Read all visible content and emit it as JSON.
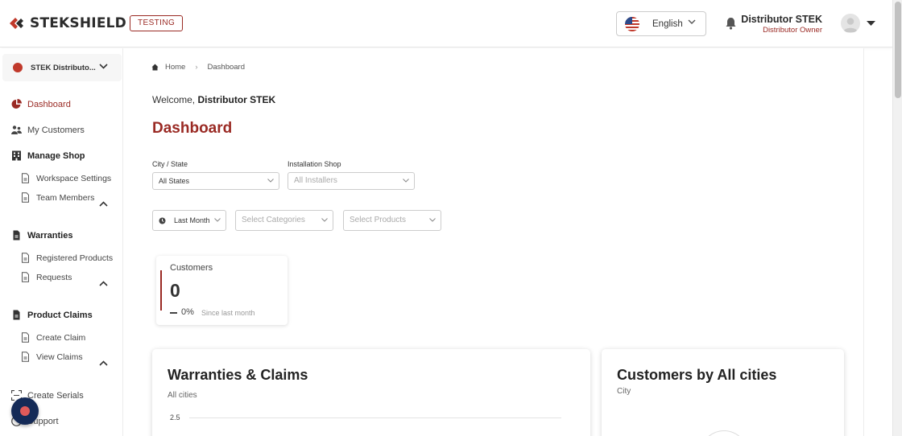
{
  "header": {
    "brand": "STEKSHIELD",
    "env_badge": "TESTING",
    "language": "English",
    "user_name": "Distributor STEK",
    "user_role": "Distributor Owner"
  },
  "sidebar": {
    "workspace": "STEK Distributo...",
    "items": [
      {
        "label": "Dashboard",
        "icon": "pie-chart-icon",
        "active": true
      },
      {
        "label": "My Customers",
        "icon": "users-icon"
      },
      {
        "label": "Manage Shop",
        "icon": "building-icon",
        "group": true,
        "expanded": true
      },
      {
        "label": "Workspace Settings",
        "icon": "document-icon"
      },
      {
        "label": "Team Members",
        "icon": "document-icon"
      },
      {
        "label": "Warranties",
        "icon": "file-icon",
        "group": true,
        "expanded": true
      },
      {
        "label": "Registered Products",
        "icon": "document-icon"
      },
      {
        "label": "Requests",
        "icon": "document-icon"
      },
      {
        "label": "Product Claims",
        "icon": "file-icon",
        "group": true,
        "expanded": true
      },
      {
        "label": "Create Claim",
        "icon": "document-icon"
      },
      {
        "label": "View Claims",
        "icon": "document-icon"
      },
      {
        "label": "Create Serials",
        "icon": "scan-icon"
      },
      {
        "label": "Support",
        "icon": "help-icon"
      }
    ]
  },
  "breadcrumb": {
    "home": "Home",
    "current": "Dashboard"
  },
  "welcome": {
    "prefix": "Welcome,",
    "name": "Distributor STEK"
  },
  "page_title": "Dashboard",
  "filters": {
    "city_label": "City / State",
    "city_value": "All States",
    "shop_label": "Installation Shop",
    "shop_placeholder": "All Installers",
    "period_value": "Last Month",
    "categories_placeholder": "Select Categories",
    "products_placeholder": "Select Products"
  },
  "kpi": {
    "title": "Customers",
    "value": "0",
    "change": "0%",
    "since": "Since last month"
  },
  "warranties_card": {
    "title": "Warranties & Claims",
    "subtitle": "All cities",
    "y_tick": "2.5"
  },
  "customers_card": {
    "title": "Customers by All cities",
    "subtitle": "City"
  },
  "colors": {
    "accent": "#9a2a24",
    "brand_red": "#c0392b",
    "fab": "#142a57"
  }
}
